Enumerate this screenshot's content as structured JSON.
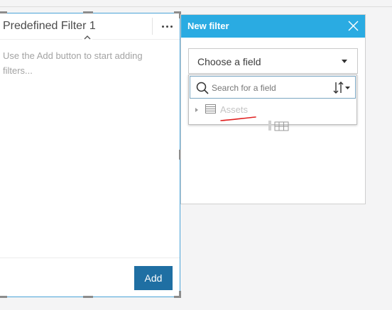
{
  "filter_card": {
    "title": "Predefined Filter 1",
    "hint": "Use the Add button to start adding filters...",
    "add_label": "Add"
  },
  "new_filter": {
    "title": "New filter",
    "field_select": {
      "label": "Choose a field"
    },
    "search": {
      "placeholder": "Search for a field"
    },
    "datasets": [
      {
        "label": "Assets"
      }
    ]
  },
  "icons": {
    "more": "more-horizontal-icon",
    "collapse": "chevron-up-icon",
    "close": "close-icon",
    "caret": "caret-down-icon",
    "search": "search-icon",
    "sort": "sort-icon",
    "expand": "caret-right-icon",
    "dataset": "table-icon"
  },
  "colors": {
    "header_blue": "#2aabe2",
    "add_button": "#1f6fa3",
    "selection_border": "#4aa3d8",
    "annotation_red": "#e02020"
  }
}
